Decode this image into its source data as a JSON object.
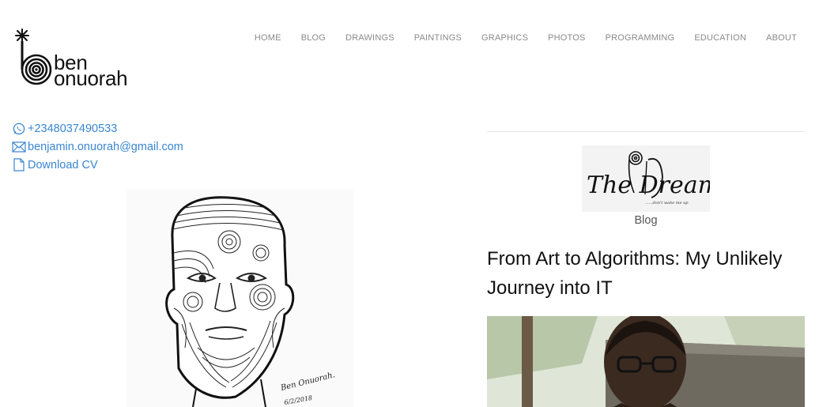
{
  "logo": {
    "line1": "ben",
    "line2": "onuorah"
  },
  "nav": [
    {
      "label": "HOME"
    },
    {
      "label": "BLOG"
    },
    {
      "label": "DRAWINGS"
    },
    {
      "label": "PAINTINGS"
    },
    {
      "label": "GRAPHICS"
    },
    {
      "label": "PHOTOS"
    },
    {
      "label": "PROGRAMMING"
    },
    {
      "label": "EDUCATION"
    },
    {
      "label": "ABOUT"
    }
  ],
  "contacts": {
    "phone": "+2348037490533",
    "email": "benjamin.onuorah@gmail.com",
    "cv": "Download CV"
  },
  "blog": {
    "logo_text": "The Dreamer",
    "logo_tagline": "......don't wake me up",
    "label": "Blog",
    "post_title": "From Art to Algorithms: My Unlikely Journey into IT"
  },
  "portrait": {
    "signature": "Ben Onuorah.",
    "date": "6/2/2018"
  },
  "colors": {
    "link": "#3a86d1",
    "nav": "#8a8a8a",
    "text": "#111111"
  }
}
